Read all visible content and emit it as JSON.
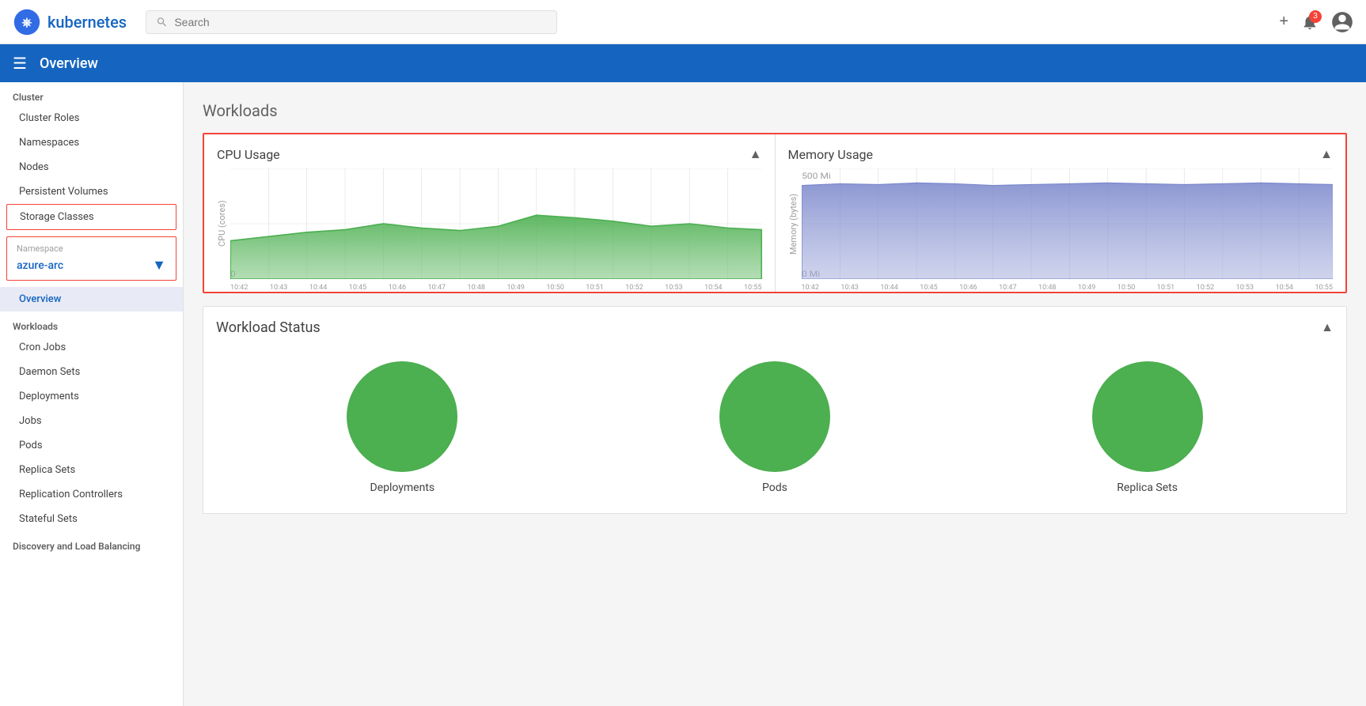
{
  "topbar": {
    "logo_text": "kubernetes",
    "search_placeholder": "Search",
    "add_label": "+",
    "notification_count": "3"
  },
  "toolbar": {
    "title": "Overview"
  },
  "sidebar": {
    "cluster_label": "Cluster",
    "cluster_items": [
      {
        "label": "Cluster Roles"
      },
      {
        "label": "Namespaces"
      },
      {
        "label": "Nodes"
      },
      {
        "label": "Persistent Volumes"
      },
      {
        "label": "Storage Classes"
      }
    ],
    "namespace_label": "Namespace",
    "namespace_value": "azure-arc",
    "nav_overview": "Overview",
    "workloads_label": "Workloads",
    "workload_items": [
      {
        "label": "Cron Jobs"
      },
      {
        "label": "Daemon Sets"
      },
      {
        "label": "Deployments"
      },
      {
        "label": "Jobs"
      },
      {
        "label": "Pods"
      },
      {
        "label": "Replica Sets"
      },
      {
        "label": "Replication Controllers"
      },
      {
        "label": "Stateful Sets"
      }
    ],
    "discovery_label": "Discovery and Load Balancing"
  },
  "main": {
    "section_title": "Workloads",
    "cpu_chart": {
      "title": "CPU Usage",
      "y_label": "CPU (cores)",
      "y_max": "",
      "y_zero": "0",
      "x_labels": [
        "10:42",
        "10:43",
        "10:44",
        "10:45",
        "10:46",
        "10:47",
        "10:48",
        "10:49",
        "10:50",
        "10:51",
        "10:52",
        "10:53",
        "10:54",
        "10:55"
      ]
    },
    "memory_chart": {
      "title": "Memory Usage",
      "y_label": "Memory (bytes)",
      "y_500": "500 Mi",
      "y_zero": "0 Mi",
      "x_labels": [
        "10:42",
        "10:43",
        "10:44",
        "10:45",
        "10:46",
        "10:47",
        "10:48",
        "10:49",
        "10:50",
        "10:51",
        "10:52",
        "10:53",
        "10:54",
        "10:55"
      ]
    },
    "workload_status": {
      "title": "Workload Status",
      "items": [
        {
          "label": "Deployments"
        },
        {
          "label": "Pods"
        },
        {
          "label": "Replica Sets"
        }
      ]
    }
  }
}
